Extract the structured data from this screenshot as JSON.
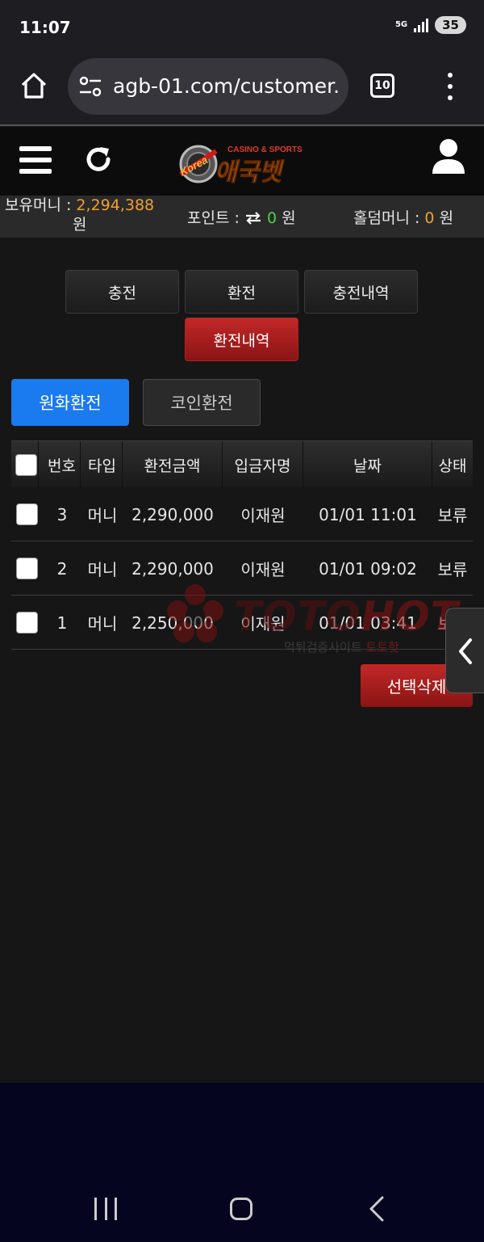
{
  "status_bar": {
    "time": "11:07",
    "network": "5G",
    "battery": "35"
  },
  "browser": {
    "url": "agb-01.com/customer.",
    "tab_count": "10",
    "icons": [
      "home-icon",
      "site-settings-icon",
      "tabs-icon",
      "more-icon"
    ]
  },
  "header": {
    "logo_top": "CASINO & SPORTS",
    "logo_main": "애국벳",
    "logo_badge": "Korea",
    "icons": [
      "menu-icon",
      "refresh-icon",
      "user-icon"
    ]
  },
  "balance": {
    "money_label": "보유머니 :",
    "money_value": "2,294,388",
    "money_unit": "원",
    "points_label": "포인트 :",
    "points_value": "0",
    "points_unit": "원",
    "hold_label": "홀덤머니 :",
    "hold_value": "0",
    "hold_unit": "원"
  },
  "tabs": [
    {
      "label": "충전",
      "active": false
    },
    {
      "label": "환전",
      "active": false
    },
    {
      "label": "충전내역",
      "active": false
    },
    {
      "label": "환전내역",
      "active": true
    }
  ],
  "currency_tabs": {
    "won": "원화환전",
    "coin": "코인환전",
    "active": "won"
  },
  "table": {
    "columns": [
      "번호",
      "타입",
      "환전금액",
      "입금자명",
      "날짜",
      "상태"
    ],
    "rows": [
      {
        "no": "3",
        "type": "머니",
        "amount": "2,290,000",
        "name": "이재원",
        "date": "01/01 11:01",
        "status": "보류"
      },
      {
        "no": "2",
        "type": "머니",
        "amount": "2,290,000",
        "name": "이재원",
        "date": "01/01 09:02",
        "status": "보류"
      },
      {
        "no": "1",
        "type": "머니",
        "amount": "2,250,000",
        "name": "이재원",
        "date": "01/01 03:41",
        "status": "보류"
      }
    ]
  },
  "delete_label": "선택삭제",
  "watermark": {
    "brand_a": "TOTO",
    "brand_b": "HOT",
    "sub_a": "먹튀검증사이트",
    "sub_b": "토토핫"
  },
  "colors": {
    "accent_blue": "#1a7af0",
    "accent_red": "#b32020",
    "money_orange": "#f0a030",
    "points_green": "#46d24a"
  }
}
